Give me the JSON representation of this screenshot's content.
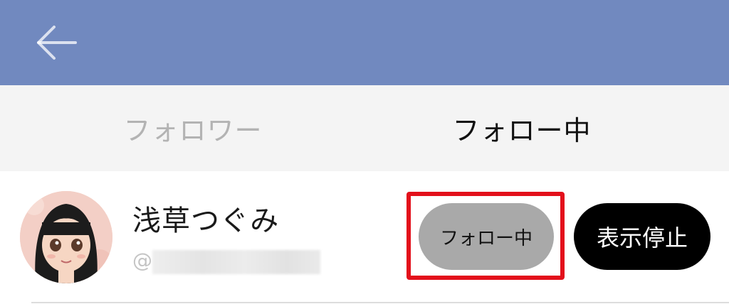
{
  "header": {
    "back_icon": "arrow-left-icon",
    "background_color": "#7189bf"
  },
  "tabs": [
    {
      "label": "フォロワー",
      "active": false
    },
    {
      "label": "フォロー中",
      "active": true
    }
  ],
  "user": {
    "name": "浅草つぐみ",
    "handle_prefix": "@",
    "avatar_icon": "avatar-image"
  },
  "actions": {
    "following_label": "フォロー中",
    "hide_label": "表示停止",
    "highlight_color": "#e3101b"
  }
}
